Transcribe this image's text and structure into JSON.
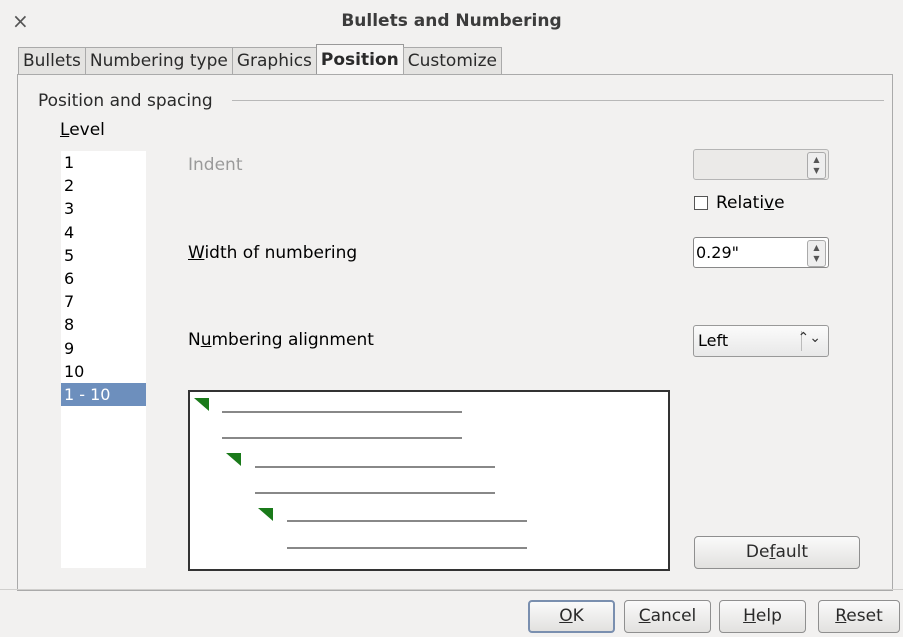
{
  "window": {
    "title": "Bullets and Numbering",
    "close_glyph": "×"
  },
  "tabs": [
    {
      "label": "Bullets",
      "active": false
    },
    {
      "label": "Numbering type",
      "active": false
    },
    {
      "label": "Graphics",
      "active": false
    },
    {
      "label": "Position",
      "active": true
    },
    {
      "label": "Customize",
      "active": false
    }
  ],
  "section": {
    "title": "Position and spacing"
  },
  "level": {
    "label": "Level",
    "items": [
      "1",
      "2",
      "3",
      "4",
      "5",
      "6",
      "7",
      "8",
      "9",
      "10",
      "1 - 10"
    ],
    "selected": "1 - 10"
  },
  "indent": {
    "label": "Indent",
    "value": "",
    "enabled": false
  },
  "relative": {
    "label": "Relative",
    "checked": false
  },
  "width_of_numbering": {
    "label": "Width of numbering",
    "value": "0.29\""
  },
  "numbering_alignment": {
    "label": "Numbering alignment",
    "value": "Left"
  },
  "buttons": {
    "default": "Default",
    "ok": "OK",
    "cancel": "Cancel",
    "help": "Help",
    "reset": "Reset"
  },
  "colors": {
    "selection": "#6d8fbd",
    "preview_marker": "#1a7a1a",
    "preview_line": "#888888"
  }
}
